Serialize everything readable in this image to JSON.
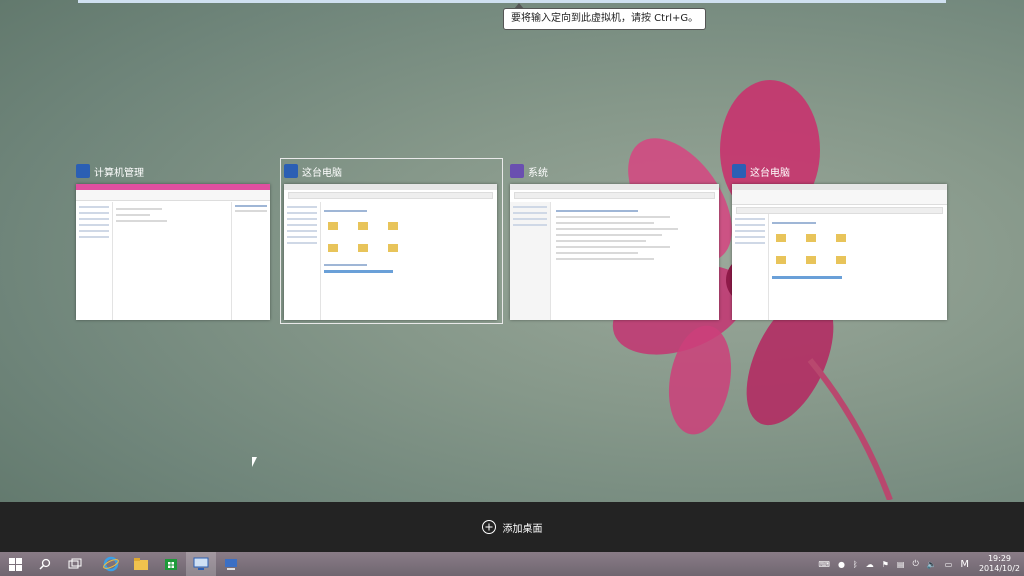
{
  "tooltip": "要将输入定向到此虚拟机，请按 Ctrl+G。",
  "windows": [
    {
      "title": "计算机管理",
      "icon": "computer-management-icon"
    },
    {
      "title": "这台电脑",
      "icon": "this-pc-icon"
    },
    {
      "title": "系统",
      "icon": "system-icon"
    },
    {
      "title": "这台电脑",
      "icon": "this-pc-icon"
    }
  ],
  "add_desktop_label": "添加桌面",
  "taskbar": {
    "clock_time": "19:29",
    "clock_date": "2014/10/2",
    "ime_label": "M"
  },
  "colors": {
    "pink_titlebar": "#e04fa0",
    "taskbar": "#7b7079",
    "bottom_bar": "#232323"
  }
}
